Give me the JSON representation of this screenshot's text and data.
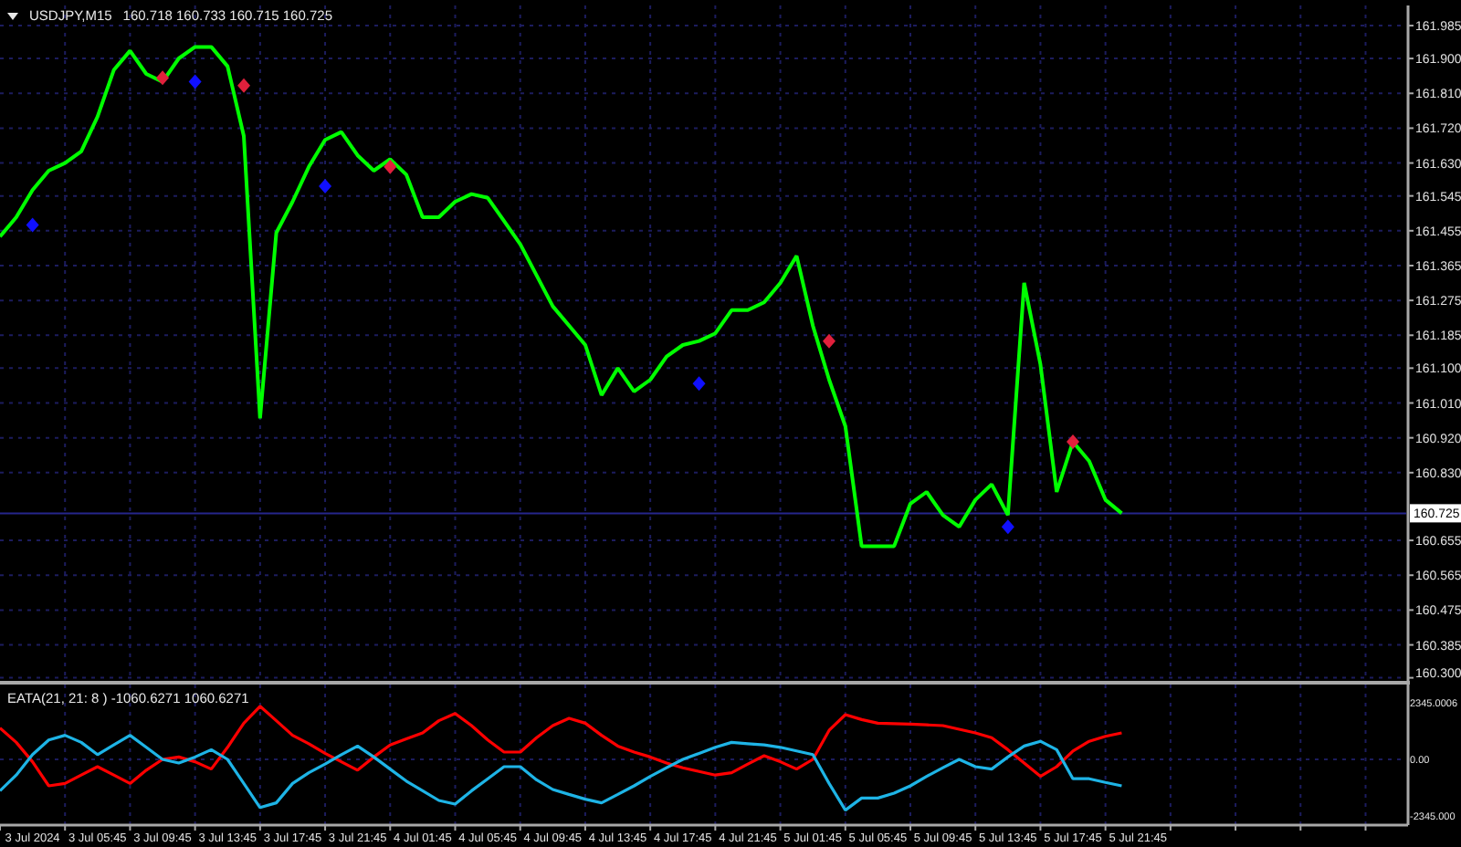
{
  "price_chart": {
    "symbol": "USDJPY,M15",
    "quotes": "160.718 160.733 160.715 160.725",
    "chart_data": {
      "type": "line",
      "grid": true,
      "ref_lines": [
        {
          "axis": "y",
          "value": 160.725,
          "label": "160.725",
          "color": "#26268c"
        }
      ],
      "series": [
        {
          "color": "#00ff00",
          "values": [
            161.44,
            161.49,
            161.56,
            161.61,
            161.63,
            161.66,
            161.75,
            161.87,
            161.92,
            161.86,
            161.84,
            161.9,
            161.93,
            161.93,
            161.88,
            161.7,
            160.97,
            161.45,
            161.53,
            161.62,
            161.69,
            161.71,
            161.65,
            161.61,
            161.64,
            161.6,
            161.49,
            161.49,
            161.53,
            161.55,
            161.54,
            161.48,
            161.42,
            161.34,
            161.26,
            161.21,
            161.16,
            161.03,
            161.1,
            161.04,
            161.07,
            161.13,
            161.16,
            161.17,
            161.19,
            161.25,
            161.25,
            161.27,
            161.32,
            161.39,
            161.21,
            161.07,
            160.95,
            160.64,
            160.64,
            160.64,
            160.75,
            160.78,
            160.72,
            160.69,
            160.76,
            160.8,
            160.72,
            161.32,
            161.11,
            160.78,
            160.91,
            160.86,
            160.76,
            160.725
          ]
        },
        {
          "type": "scatter",
          "color": "#1010ff",
          "values": [
            null,
            null,
            161.47,
            null,
            null,
            null,
            null,
            null,
            null,
            null,
            null,
            null,
            161.84,
            null,
            null,
            null,
            null,
            null,
            null,
            null,
            161.57,
            null,
            null,
            null,
            null,
            null,
            null,
            null,
            null,
            null,
            null,
            null,
            null,
            null,
            null,
            null,
            null,
            null,
            null,
            null,
            null,
            null,
            null,
            161.06,
            null,
            null,
            null,
            null,
            null,
            null,
            null,
            null,
            null,
            null,
            null,
            null,
            null,
            null,
            null,
            null,
            null,
            null,
            160.69,
            null,
            null,
            null,
            null,
            null,
            null,
            null
          ]
        },
        {
          "type": "scatter",
          "color": "#e0203c",
          "values": [
            null,
            null,
            null,
            null,
            null,
            null,
            null,
            null,
            null,
            null,
            161.85,
            null,
            null,
            null,
            null,
            161.83,
            null,
            null,
            null,
            null,
            null,
            null,
            null,
            null,
            161.62,
            null,
            null,
            null,
            null,
            null,
            null,
            null,
            null,
            null,
            null,
            null,
            null,
            null,
            null,
            null,
            null,
            null,
            null,
            null,
            null,
            null,
            null,
            null,
            null,
            null,
            null,
            161.17,
            null,
            null,
            null,
            null,
            null,
            null,
            null,
            null,
            null,
            null,
            null,
            null,
            null,
            null,
            160.91,
            null,
            null,
            null
          ]
        }
      ],
      "ylim": [
        160.292,
        162.037
      ],
      "yticks": [
        {
          "value": 161.985,
          "label": "161.985"
        },
        {
          "value": 161.9,
          "label": "161.900"
        },
        {
          "value": 161.81,
          "label": "161.810"
        },
        {
          "value": 161.72,
          "label": "161.720"
        },
        {
          "value": 161.63,
          "label": "161.630"
        },
        {
          "value": 161.545,
          "label": "161.545"
        },
        {
          "value": 161.455,
          "label": "161.455"
        },
        {
          "value": 161.365,
          "label": "161.365"
        },
        {
          "value": 161.275,
          "label": "161.275"
        },
        {
          "value": 161.185,
          "label": "161.185"
        },
        {
          "value": 161.1,
          "label": "161.100"
        },
        {
          "value": 161.01,
          "label": "161.010"
        },
        {
          "value": 160.92,
          "label": "160.920"
        },
        {
          "value": 160.83,
          "label": "160.830"
        },
        {
          "value": 160.655,
          "label": "160.655"
        },
        {
          "value": 160.565,
          "label": "160.565"
        },
        {
          "value": 160.475,
          "label": "160.475"
        },
        {
          "value": 160.385,
          "label": "160.385"
        },
        {
          "value": 160.3,
          "label": "160.300"
        }
      ]
    }
  },
  "indicator": {
    "label": "EATA(21, 21: 8 ) -1060.6271 1060.6271",
    "chart_data": {
      "type": "line",
      "grid": true,
      "categories": [
        null,
        null,
        "3 Jul 2024",
        null,
        null,
        null,
        "3 Jul 05:45",
        null,
        null,
        null,
        "3 Jul 09:45",
        null,
        null,
        null,
        "3 Jul 13:45",
        null,
        null,
        null,
        "3 Jul 17:45",
        null,
        null,
        null,
        "3 Jul 21:45",
        null,
        null,
        null,
        "4 Jul 01:45",
        null,
        null,
        null,
        "4 Jul 05:45",
        null,
        null,
        null,
        "4 Jul 09:45",
        null,
        null,
        null,
        "4 Jul 13:45",
        null,
        null,
        null,
        "4 Jul 17:45",
        null,
        null,
        null,
        "4 Jul 21:45",
        null,
        null,
        null,
        "5 Jul 01:45",
        null,
        null,
        null,
        "5 Jul 05:45",
        null,
        null,
        null,
        "5 Jul 09:45",
        null,
        null,
        null,
        "5 Jul 13:45",
        null,
        null,
        null,
        "5 Jul 17:45",
        null,
        null,
        null,
        "5 Jul 21:45"
      ],
      "series": [
        {
          "color": "#ff0000",
          "values": [
            1300,
            700,
            -100,
            -1100,
            -1000,
            -650,
            -300,
            -650,
            -1000,
            -450,
            0,
            100,
            -100,
            -400,
            500,
            1500,
            2200,
            1600,
            1000,
            650,
            250,
            -100,
            -450,
            100,
            600,
            850,
            1100,
            1600,
            1900,
            1400,
            800,
            300,
            300,
            900,
            1400,
            1700,
            1500,
            1000,
            550,
            300,
            100,
            -150,
            -350,
            -500,
            -650,
            -550,
            -200,
            150,
            -100,
            -400,
            0,
            1200,
            1850,
            1650,
            1500,
            1480,
            1460,
            1430,
            1400,
            1250,
            1100,
            900,
            400,
            -150,
            -700,
            -300,
            350,
            750,
            950,
            1100,
            null
          ]
        },
        {
          "color": "#1eb4e6",
          "values": [
            -1300,
            -650,
            200,
            800,
            1000,
            700,
            200,
            600,
            1000,
            500,
            0,
            -150,
            100,
            400,
            0,
            -1000,
            -2000,
            -1800,
            -1000,
            -550,
            -200,
            200,
            550,
            100,
            -400,
            -900,
            -1300,
            -1700,
            -1850,
            -1300,
            -800,
            -300,
            -300,
            -850,
            -1250,
            -1450,
            -1650,
            -1800,
            -1450,
            -1100,
            -700,
            -350,
            0,
            250,
            500,
            700,
            650,
            600,
            500,
            350,
            200,
            -1000,
            -2100,
            -1600,
            -1600,
            -1400,
            -1100,
            -700,
            -350,
            0,
            -300,
            -400,
            100,
            550,
            750,
            400,
            -800,
            -800,
            -950,
            -1100,
            null
          ]
        }
      ],
      "ylim": [
        -2723,
        3101
      ],
      "yticks": [
        {
          "value": 2345.0006,
          "label": "2345.0006"
        },
        {
          "value": 0,
          "label": "0.00"
        },
        {
          "value": -2345,
          "label": "-2345.000"
        }
      ]
    }
  }
}
